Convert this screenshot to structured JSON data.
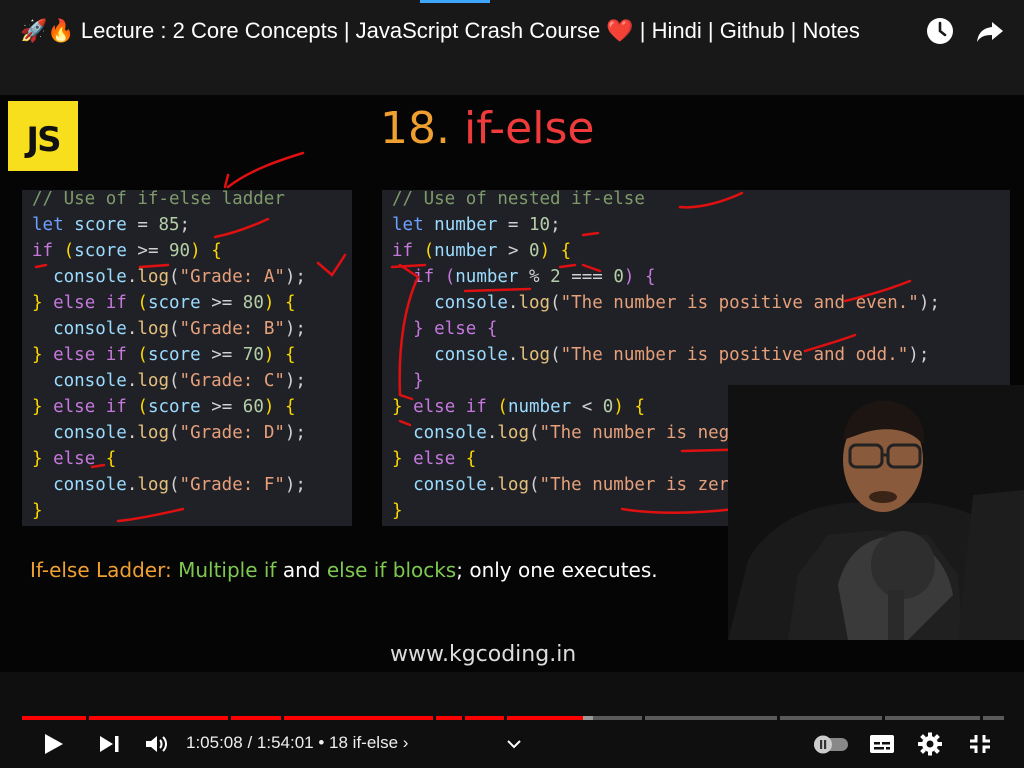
{
  "video": {
    "title": "🚀🔥 Lecture : 2 Core Concepts | JavaScript Crash Course ❤️ | Hindi | Github | Notes"
  },
  "slide": {
    "logo_text": "JS",
    "title_number": "18.",
    "title_keyword": "if-else",
    "website": "www.kgcoding.in"
  },
  "code_left": [
    "// Use of if-else ladder",
    "let score = 85;",
    "if (score >= 90) {",
    "  console.log(\"Grade: A\");",
    "} else if (score >= 80) {",
    "  console.log(\"Grade: B\");",
    "} else if (score >= 70) {",
    "  console.log(\"Grade: C\");",
    "} else if (score >= 60) {",
    "  console.log(\"Grade: D\");",
    "} else {",
    "  console.log(\"Grade: F\");",
    "}"
  ],
  "code_right": [
    "// Use of nested if-else",
    "let number = 10;",
    "if (number > 0) {",
    "  if (number % 2 === 0) {",
    "    console.log(\"The number is positive and even.\");",
    "  } else {",
    "    console.log(\"The number is positive and odd.\");",
    "  }",
    "} else if (number < 0) {",
    "  console.log(\"The number is negative.\");",
    "} else {",
    "  console.log(\"The number is zero.\");",
    "}"
  ],
  "caption": {
    "part1": "If-else Ladder:",
    "part2": "Multiple if",
    "part3": "and",
    "part4": "else if blocks",
    "part5": "; only one executes."
  },
  "player": {
    "current_time": "1:05:08",
    "separator": " / ",
    "duration": "1:54:01",
    "chapter": " • 18 if-else ›",
    "progress_fraction": 0.571,
    "buffered_fraction": 0.581,
    "accent_color": "#ff0000"
  },
  "icons": {
    "watch_later": "clock-icon",
    "share": "share-icon",
    "play": "play-icon",
    "next": "next-icon",
    "volume": "volume-icon",
    "chapter_expand": "chevron-down-icon",
    "autoplay": "autoplay-toggle",
    "subtitles": "subtitles-icon",
    "settings": "gear-icon",
    "fullscreen": "fullscreen-icon"
  }
}
